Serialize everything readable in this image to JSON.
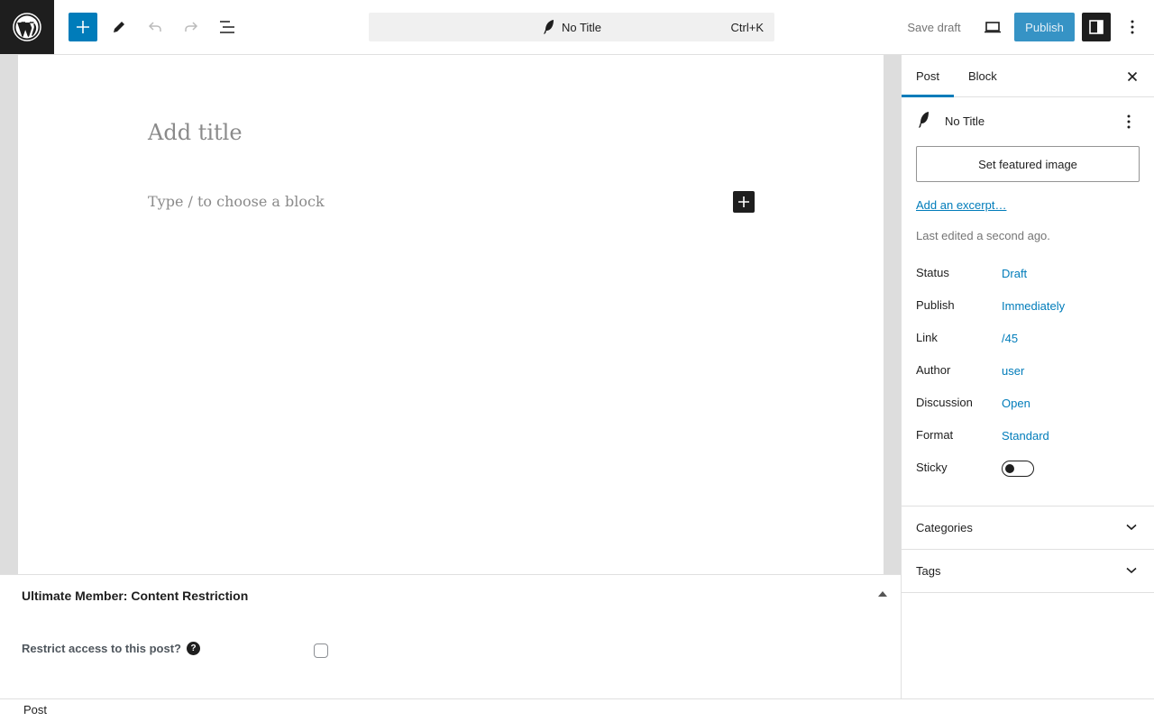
{
  "header": {
    "document_title": "No Title",
    "shortcut": "Ctrl+K",
    "save_draft": "Save draft",
    "publish": "Publish"
  },
  "editor": {
    "title_placeholder": "Add title",
    "block_placeholder": "Type / to choose a block"
  },
  "metabox": {
    "title": "Ultimate Member: Content Restriction",
    "restrict_label": "Restrict access to this post?",
    "help_glyph": "?",
    "restrict_checked": false
  },
  "footer": {
    "breadcrumb": "Post"
  },
  "sidebar": {
    "tabs": [
      "Post",
      "Block"
    ],
    "post_title": "No Title",
    "featured_image_button": "Set featured image",
    "excerpt_link": "Add an excerpt…",
    "last_edited": "Last edited a second ago.",
    "rows": [
      {
        "label": "Status",
        "value": "Draft"
      },
      {
        "label": "Publish",
        "value": "Immediately"
      },
      {
        "label": "Link",
        "value": "/45"
      },
      {
        "label": "Author",
        "value": "user"
      },
      {
        "label": "Discussion",
        "value": "Open"
      },
      {
        "label": "Format",
        "value": "Standard"
      },
      {
        "label": "Sticky",
        "value": ""
      }
    ],
    "sticky_on": false,
    "panels": [
      "Categories",
      "Tags"
    ]
  },
  "colors": {
    "accent": "#007cba",
    "publish_bg": "#3693c5",
    "dark": "#1e1e1e"
  }
}
